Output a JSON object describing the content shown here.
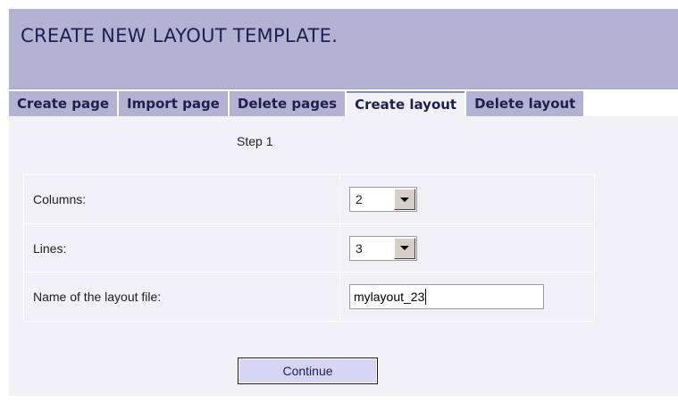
{
  "header": {
    "title": "CREATE NEW LAYOUT TEMPLATE."
  },
  "tabs": [
    {
      "label": "Create page",
      "active": false
    },
    {
      "label": "Import page",
      "active": false
    },
    {
      "label": "Delete pages",
      "active": false
    },
    {
      "label": "Create layout",
      "active": true
    },
    {
      "label": "Delete layout",
      "active": false
    }
  ],
  "form": {
    "step": "Step 1",
    "columns": {
      "label": "Columns:",
      "value": "2"
    },
    "lines": {
      "label": "Lines:",
      "value": "3"
    },
    "filename": {
      "label": "Name of the layout file:",
      "value": "mylayout_23"
    },
    "continue_label": "Continue"
  },
  "colors": {
    "header_bg": "#b2b2d2",
    "content_bg": "#f1f1f6",
    "title_text": "#1e1e50",
    "button_bg": "#d6d6f4"
  }
}
